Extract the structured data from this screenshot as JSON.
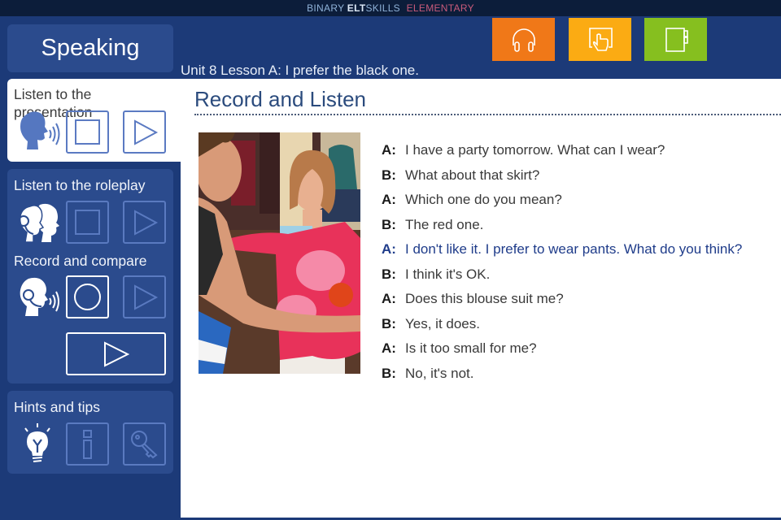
{
  "topbar": {
    "brand_part1": "BINARY",
    "brand_part2": "ELT",
    "brand_part3": "SKILLS",
    "brand_part4": "ELEMENTARY"
  },
  "tiles": [
    {
      "name": "listening",
      "icon": "headphones-icon",
      "color": "#f07818"
    },
    {
      "name": "interactive",
      "icon": "touch-hand-icon",
      "color": "#fbab13"
    },
    {
      "name": "notebook",
      "icon": "notebook-icon",
      "color": "#86bf1f"
    }
  ],
  "sidebar": {
    "title": "Speaking",
    "sections": [
      {
        "label": "Listen to the presentation",
        "icon": "speaking-head-icon",
        "buttons": [
          "stop",
          "play"
        ]
      },
      {
        "label": "Listen to the roleplay",
        "icon": "two-heads-headset-icon",
        "buttons": [
          "stop",
          "play"
        ]
      },
      {
        "label": "Record and compare",
        "icon": "headset-speaking-icon",
        "buttons": [
          "record",
          "play",
          "play-compare"
        ]
      },
      {
        "label": "Hints and tips",
        "icon": "lightbulb-icon",
        "buttons": [
          "info",
          "key"
        ]
      }
    ]
  },
  "lesson": {
    "title": "Unit 8 Lesson A: I prefer the black one."
  },
  "main": {
    "section_title": "Record and Listen",
    "photo_alt": "Man holding up a pink tie-dye blouse to a smiling woman in a clothing shop",
    "dialog": [
      {
        "speaker": "A:",
        "text": "I have a party tomorrow. What can I wear?",
        "active": false
      },
      {
        "speaker": "B:",
        "text": "What about that skirt?",
        "active": false
      },
      {
        "speaker": "A:",
        "text": "Which one do you mean?",
        "active": false
      },
      {
        "speaker": "B:",
        "text": "The red one.",
        "active": false
      },
      {
        "speaker": "A:",
        "text": "I don't like it. I prefer to wear pants. What do you think?",
        "active": true
      },
      {
        "speaker": "B:",
        "text": "I think it's OK.",
        "active": false
      },
      {
        "speaker": "A:",
        "text": "Does this blouse suit me?",
        "active": false
      },
      {
        "speaker": "B:",
        "text": "Yes, it does.",
        "active": false
      },
      {
        "speaker": "A:",
        "text": "Is it too small for me?",
        "active": false
      },
      {
        "speaker": "B:",
        "text": "No, it's not.",
        "active": false
      }
    ]
  },
  "colors": {
    "background": "#1c3a78",
    "panel": "#2b4b8d",
    "active_line": "#1f3c8a",
    "title": "#2b4b7d"
  }
}
